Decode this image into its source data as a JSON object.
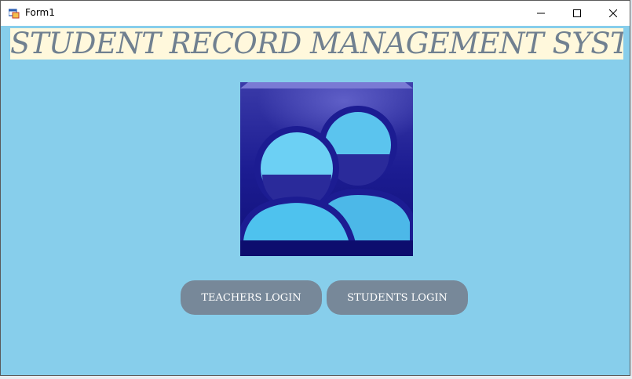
{
  "window": {
    "title": "Form1",
    "icon": "windows-form-icon",
    "controls": [
      "minimize-icon",
      "maximize-icon",
      "close-icon"
    ]
  },
  "header": {
    "title": "STUDENT RECORD MANAGEMENT SYSTEM"
  },
  "logo": {
    "icon": "users-icon"
  },
  "buttons": {
    "teachers_login": "TEACHERS LOGIN",
    "students_login": "STUDENTS LOGIN"
  },
  "colors": {
    "form_background": "#87ceeb",
    "header_background": "#fff8dc",
    "header_text": "#708090",
    "button_background": "#778899",
    "button_text": "#ffffff",
    "logo_dark": "#1a1a8c",
    "logo_light": "#5bc4ee"
  }
}
